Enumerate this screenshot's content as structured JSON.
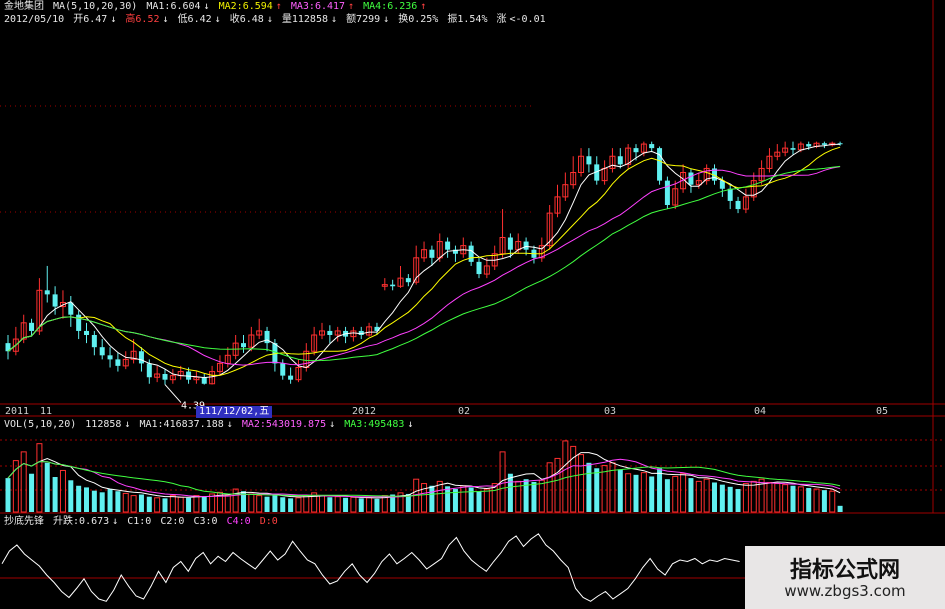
{
  "header": {
    "stock_name": "金地集团",
    "ma_label": "MA(5,10,20,30)",
    "ma1": "MA1:6.604",
    "ma1_arrow": "↓",
    "ma2": "MA2:6.594",
    "ma2_arrow": "↑",
    "ma3": "MA3:6.417",
    "ma3_arrow": "↑",
    "ma4": "MA4:6.236",
    "ma4_arrow": "↑",
    "date": "2012/05/10",
    "open": "开6.47",
    "open_arrow": "↓",
    "high": "高6.52",
    "high_arrow": "↓",
    "low": "低6.42",
    "low_arrow": "↓",
    "close": "收6.48",
    "close_arrow": "↓",
    "volume": "量112858",
    "volume_arrow": "↓",
    "amount": "额7299",
    "amount_arrow": "↓",
    "turnover": "换0.25%",
    "amplitude": "振1.54%",
    "change": "涨",
    "change_value": "<-0.01"
  },
  "time_axis": {
    "labels": [
      "2011",
      "11",
      "2012",
      "02",
      "03",
      "04",
      "05"
    ],
    "cursor_date": "111/12/02,五"
  },
  "volume_header": {
    "label": "VOL(5,10,20)",
    "value": "112858",
    "value_arrow": "↓",
    "ma1": "MA1:416837.188",
    "ma1_arrow": "↓",
    "ma2": "MA2:543019.875",
    "ma2_arrow": "↓",
    "ma3": "MA3:495483",
    "ma3_arrow": "↓"
  },
  "indicator_header": {
    "name": "抄底先锋",
    "rise_fall": "升跌:0.673",
    "rise_fall_arrow": "↓",
    "c1": "C1:0",
    "c2": "C2:0",
    "c3": "C3:0",
    "c4": "C4:0",
    "d": "D:0"
  },
  "price_annotation": "4.39",
  "watermark": {
    "title": "指标公式网",
    "url": "www.zbgs3.com"
  },
  "colors": {
    "up": "#ff3030",
    "down": "#60f0f0",
    "ma1": "#ffffff",
    "ma2": "#ffff00",
    "ma3": "#ff40ff",
    "ma4": "#40ff40",
    "grid": "#a00000",
    "osc": "#ffffff"
  },
  "chart_data": {
    "type": "candlestick",
    "price_axis_range": [
      4.2,
      7.4
    ],
    "candles": [
      [
        4.9,
        4.8,
        5.0,
        4.7
      ],
      [
        4.8,
        4.95,
        5.1,
        4.75
      ],
      [
        4.95,
        5.15,
        5.25,
        4.9
      ],
      [
        5.15,
        5.05,
        5.2,
        4.98
      ],
      [
        5.05,
        5.55,
        5.7,
        5.0
      ],
      [
        5.55,
        5.5,
        5.85,
        5.4
      ],
      [
        5.5,
        5.35,
        5.6,
        5.25
      ],
      [
        5.35,
        5.4,
        5.55,
        5.2
      ],
      [
        5.4,
        5.25,
        5.48,
        5.1
      ],
      [
        5.25,
        5.05,
        5.3,
        4.95
      ],
      [
        5.05,
        5.0,
        5.15,
        4.9
      ],
      [
        5.0,
        4.85,
        5.05,
        4.75
      ],
      [
        4.85,
        4.75,
        4.95,
        4.7
      ],
      [
        4.75,
        4.7,
        4.85,
        4.6
      ],
      [
        4.7,
        4.62,
        4.78,
        4.55
      ],
      [
        4.62,
        4.7,
        4.8,
        4.58
      ],
      [
        4.7,
        4.8,
        4.95,
        4.65
      ],
      [
        4.8,
        4.65,
        4.85,
        4.55
      ],
      [
        4.65,
        4.48,
        4.7,
        4.4
      ],
      [
        4.48,
        4.52,
        4.62,
        4.42
      ],
      [
        4.52,
        4.45,
        4.58,
        4.39
      ],
      [
        4.45,
        4.5,
        4.58,
        4.4
      ],
      [
        4.5,
        4.55,
        4.62,
        4.45
      ],
      [
        4.55,
        4.45,
        4.6,
        4.4
      ],
      [
        4.45,
        4.48,
        4.55,
        4.4
      ],
      [
        4.48,
        4.4,
        4.52,
        4.39
      ],
      [
        4.4,
        4.55,
        4.62,
        4.39
      ],
      [
        4.55,
        4.65,
        4.75,
        4.5
      ],
      [
        4.65,
        4.75,
        4.85,
        4.6
      ],
      [
        4.75,
        4.9,
        5.0,
        4.7
      ],
      [
        4.9,
        4.85,
        5.0,
        4.78
      ],
      [
        4.85,
        5.0,
        5.1,
        4.8
      ],
      [
        5.0,
        5.05,
        5.2,
        4.95
      ],
      [
        5.05,
        4.9,
        5.1,
        4.8
      ],
      [
        4.9,
        4.65,
        4.95,
        4.55
      ],
      [
        4.65,
        4.5,
        4.7,
        4.45
      ],
      [
        4.5,
        4.45,
        4.6,
        4.4
      ],
      [
        4.45,
        4.6,
        4.7,
        4.42
      ],
      [
        4.6,
        4.8,
        4.9,
        4.55
      ],
      [
        4.8,
        5.0,
        5.1,
        4.75
      ],
      [
        5.0,
        5.05,
        5.15,
        4.95
      ],
      [
        5.05,
        5.0,
        5.12,
        4.9
      ],
      [
        5.0,
        5.05,
        5.1,
        4.92
      ],
      [
        5.05,
        4.98,
        5.1,
        4.9
      ],
      [
        4.98,
        5.05,
        5.1,
        4.92
      ],
      [
        5.05,
        5.0,
        5.1,
        4.95
      ],
      [
        5.0,
        5.1,
        5.15,
        4.98
      ],
      [
        5.1,
        5.05,
        5.15,
        5.0
      ],
      [
        5.6,
        5.62,
        5.7,
        5.55
      ],
      [
        5.62,
        5.6,
        5.68,
        5.55
      ],
      [
        5.6,
        5.7,
        5.85,
        5.58
      ],
      [
        5.7,
        5.65,
        5.75,
        5.6
      ],
      [
        5.65,
        5.95,
        6.1,
        5.62
      ],
      [
        5.95,
        6.05,
        6.15,
        5.9
      ],
      [
        6.05,
        5.95,
        6.1,
        5.85
      ],
      [
        5.95,
        6.15,
        6.25,
        5.9
      ],
      [
        6.15,
        6.05,
        6.2,
        5.95
      ],
      [
        6.05,
        6.0,
        6.1,
        5.9
      ],
      [
        6.0,
        6.1,
        6.2,
        5.95
      ],
      [
        6.1,
        5.9,
        6.15,
        5.85
      ],
      [
        5.9,
        5.75,
        5.95,
        5.7
      ],
      [
        5.75,
        5.85,
        5.95,
        5.7
      ],
      [
        5.85,
        6.0,
        6.1,
        5.8
      ],
      [
        6.0,
        6.2,
        6.55,
        5.95
      ],
      [
        6.2,
        6.05,
        6.25,
        5.95
      ],
      [
        6.05,
        6.15,
        6.25,
        6.0
      ],
      [
        6.15,
        6.05,
        6.2,
        5.98
      ],
      [
        6.05,
        5.95,
        6.1,
        5.88
      ],
      [
        5.95,
        6.1,
        6.2,
        5.9
      ],
      [
        6.1,
        6.5,
        6.6,
        6.05
      ],
      [
        6.5,
        6.7,
        6.85,
        6.45
      ],
      [
        6.7,
        6.85,
        7.0,
        6.65
      ],
      [
        6.85,
        7.0,
        7.2,
        6.8
      ],
      [
        7.0,
        7.2,
        7.3,
        6.95
      ],
      [
        7.2,
        7.1,
        7.3,
        7.0
      ],
      [
        7.1,
        6.9,
        7.2,
        6.85
      ],
      [
        6.9,
        7.05,
        7.15,
        6.85
      ],
      [
        7.05,
        7.2,
        7.3,
        7.0
      ],
      [
        7.2,
        7.1,
        7.3,
        7.05
      ],
      [
        7.1,
        7.3,
        7.35,
        7.05
      ],
      [
        7.3,
        7.25,
        7.35,
        7.15
      ],
      [
        7.25,
        7.35,
        7.38,
        7.2
      ],
      [
        7.35,
        7.3,
        7.38,
        7.25
      ],
      [
        7.3,
        6.9,
        7.32,
        6.85
      ],
      [
        6.9,
        6.6,
        6.95,
        6.55
      ],
      [
        6.6,
        6.8,
        6.9,
        6.55
      ],
      [
        6.8,
        7.0,
        7.1,
        6.75
      ],
      [
        7.0,
        6.85,
        7.05,
        6.75
      ],
      [
        6.85,
        6.9,
        7.0,
        6.8
      ],
      [
        6.9,
        7.05,
        7.1,
        6.85
      ],
      [
        7.05,
        6.9,
        7.1,
        6.85
      ],
      [
        6.9,
        6.8,
        6.95,
        6.7
      ],
      [
        6.8,
        6.65,
        6.85,
        6.55
      ],
      [
        6.65,
        6.55,
        6.7,
        6.5
      ],
      [
        6.55,
        6.7,
        6.8,
        6.5
      ],
      [
        6.7,
        6.9,
        7.0,
        6.65
      ],
      [
        6.9,
        7.05,
        7.15,
        6.85
      ],
      [
        7.05,
        7.2,
        7.3,
        7.0
      ],
      [
        7.2,
        7.25,
        7.35,
        7.15
      ],
      [
        7.25,
        7.3,
        7.38,
        7.2
      ],
      [
        7.3,
        7.28,
        7.38,
        7.22
      ],
      [
        7.28,
        7.35,
        7.38,
        7.25
      ],
      [
        7.35,
        7.32,
        7.38,
        7.28
      ],
      [
        7.32,
        7.36,
        7.38,
        7.3
      ],
      [
        7.36,
        7.34,
        7.38,
        7.3
      ],
      [
        7.34,
        7.36,
        7.38,
        7.32
      ],
      [
        7.36,
        7.35,
        7.38,
        7.33
      ]
    ],
    "volume_range": [
      0,
      1500000
    ],
    "volumes": [
      620000,
      940000,
      1100000,
      700000,
      1250000,
      900000,
      640000,
      760000,
      580000,
      480000,
      450000,
      390000,
      360000,
      420000,
      380000,
      340000,
      300000,
      320000,
      280000,
      260000,
      250000,
      300000,
      270000,
      260000,
      300000,
      280000,
      330000,
      360000,
      300000,
      420000,
      380000,
      330000,
      300000,
      280000,
      320000,
      270000,
      250000,
      260000,
      300000,
      350000,
      300000,
      270000,
      280000,
      260000,
      270000,
      250000,
      260000,
      240000,
      300000,
      320000,
      350000,
      330000,
      600000,
      520000,
      480000,
      560000,
      470000,
      420000,
      480000,
      450000,
      380000,
      420000,
      520000,
      1100000,
      700000,
      560000,
      600000,
      550000,
      580000,
      900000,
      980000,
      1300000,
      1200000,
      1050000,
      900000,
      800000,
      850000,
      900000,
      780000,
      700000,
      680000,
      720000,
      650000,
      800000,
      600000,
      650000,
      700000,
      620000,
      560000,
      600000,
      540000,
      500000,
      460000,
      420000,
      520000,
      560000,
      600000,
      540000,
      520000,
      500000,
      480000,
      460000,
      440000,
      420000,
      400000,
      380000,
      112858
    ],
    "oscillator_range": [
      0,
      1
    ],
    "oscillator": [
      0.55,
      0.72,
      0.8,
      0.68,
      0.6,
      0.52,
      0.4,
      0.3,
      0.18,
      0.1,
      0.22,
      0.35,
      0.18,
      0.08,
      0.05,
      0.2,
      0.4,
      0.25,
      0.12,
      0.08,
      0.25,
      0.45,
      0.3,
      0.5,
      0.58,
      0.45,
      0.62,
      0.7,
      0.55,
      0.65,
      0.58,
      0.7,
      0.62,
      0.55,
      0.48,
      0.6,
      0.72,
      0.6,
      0.68,
      0.85,
      0.72,
      0.6,
      0.55,
      0.4,
      0.28,
      0.32,
      0.45,
      0.55,
      0.4,
      0.3,
      0.42,
      0.58,
      0.68,
      0.55,
      0.62,
      0.7,
      0.6,
      0.48,
      0.55,
      0.62,
      0.8,
      0.9,
      0.72,
      0.6,
      0.52,
      0.45,
      0.58,
      0.7,
      0.85,
      0.92,
      0.78,
      0.88,
      0.95,
      0.8,
      0.72,
      0.6,
      0.5,
      0.22,
      0.1,
      0.05,
      0.12,
      0.18,
      0.08,
      0.15,
      0.22,
      0.35,
      0.5,
      0.62,
      0.48,
      0.4,
      0.55,
      0.6,
      0.58,
      0.62,
      0.55,
      0.6,
      0.58,
      0.62,
      0.6,
      0.58
    ]
  }
}
